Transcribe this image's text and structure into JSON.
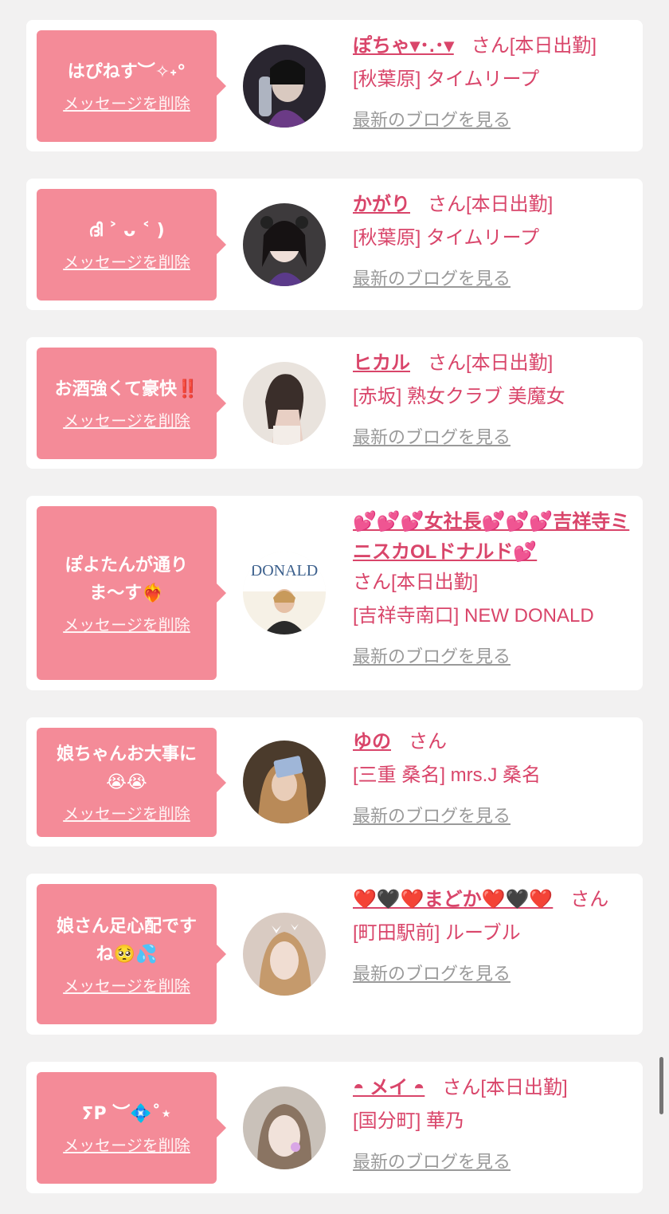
{
  "delete_label": "メッセージを削除",
  "blog_label": "最新のブログを見る",
  "cards": [
    {
      "message": "はぴねす︶✧˖°",
      "name": "ぽちゃ▾･.･▾",
      "san": "さん[本日出勤]",
      "shop": "[秋葉原] タイムリープ"
    },
    {
      "message": "ദി ˃ ᴗ ˂ )",
      "name": "かがり",
      "san": "さん[本日出勤]",
      "shop": "[秋葉原] タイムリープ"
    },
    {
      "message": "お酒強くて豪快‼️",
      "name": "ヒカル",
      "san": "さん[本日出勤]",
      "shop": "[赤坂] 熟女クラブ 美魔女"
    },
    {
      "message": "ぽよたんが通り\nま〜す❤️‍🔥",
      "name": "💕💕💕女社長💕💕💕吉祥寺ミニスカOLドナルド💕",
      "san": "さん[本日出勤]",
      "shop": "[吉祥寺南口] NEW DONALD"
    },
    {
      "message": "娘ちゃんお大事に\n😭😭",
      "name": "ゆの",
      "san": "さん",
      "shop": "[三重 桑名] mrs.J 桑名"
    },
    {
      "message": "娘さん足心配です\nね🥺💦",
      "name": "❤️🖤❤️まどか❤️🖤❤️",
      "san": "さん",
      "shop": "[町田駅前] ルーブル"
    },
    {
      "message": "ⵢP ︶💠˚⋆",
      "name": "◓ メイ ◓",
      "san": "さん[本日出勤]",
      "shop": "[国分町] 華乃"
    }
  ],
  "colors": {
    "accent": "#f48b98",
    "name": "#d9456a",
    "link_gray": "#9a9a9a"
  }
}
